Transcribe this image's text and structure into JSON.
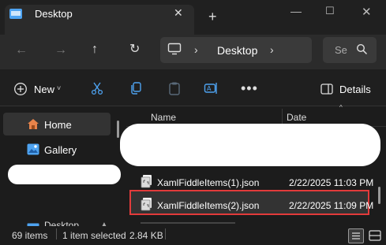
{
  "window": {
    "tab_title": "Desktop",
    "tab_close": "✕",
    "new_tab": "+",
    "minimize": "—",
    "maximize": "☐",
    "close": "✕"
  },
  "navigation": {
    "back": "←",
    "forward": "→",
    "up": "↑",
    "refresh": "↻",
    "breadcrumb": {
      "separator": "›",
      "current": "Desktop"
    },
    "search_placeholder": "Se"
  },
  "toolbar": {
    "new_label": "New",
    "new_chevron": "˅",
    "more": "•••",
    "details_label": "Details",
    "icons": [
      "new-icon",
      "cut-icon",
      "copy-icon",
      "paste-icon",
      "rename-icon",
      "more-icon",
      "details-pane-icon"
    ]
  },
  "sidebar": {
    "items": [
      {
        "label": "Home",
        "icon": "home-icon",
        "selected": true
      },
      {
        "label": "Gallery",
        "icon": "gallery-icon",
        "selected": false
      },
      {
        "label": "Desktop",
        "icon": "desktop-icon",
        "pinned": true
      }
    ]
  },
  "file_list": {
    "columns": {
      "name": "Name",
      "date": "Date"
    },
    "sort_indicator": "^",
    "rows": [
      {
        "name": "XamlFiddleItems(1).json",
        "date": "2/22/2025 11:03 PM",
        "selected": false
      },
      {
        "name": "XamlFiddleItems(2).json",
        "date": "2/22/2025 11:09 PM",
        "selected": true
      }
    ]
  },
  "status": {
    "item_count": "69 items",
    "selection": "1 item selected",
    "size": "2.84 KB"
  },
  "colors": {
    "background": "#1c1c1c",
    "titlebar": "#202020",
    "toolbar_panel": "#2b2b2b",
    "selected_row": "#333333",
    "highlight_border": "#e23b3b",
    "accent_blue": "#4ea3f1",
    "home_orange": "#e8834a"
  }
}
